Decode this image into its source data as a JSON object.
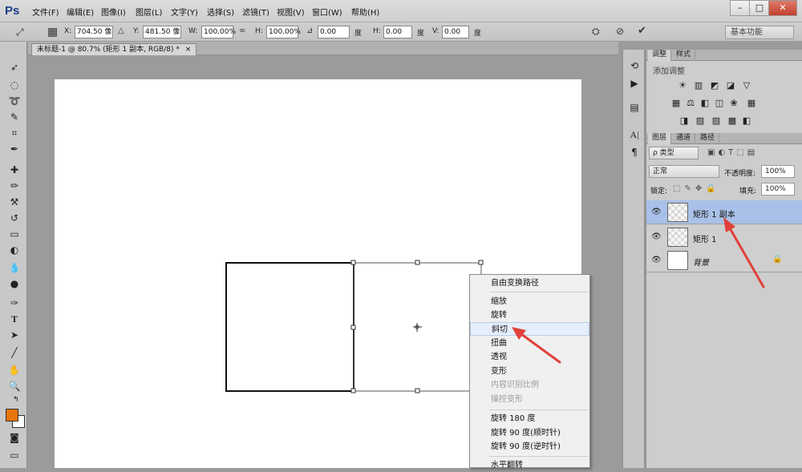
{
  "menubar": {
    "logo": "Ps",
    "items": [
      "文件(F)",
      "编辑(E)",
      "图像(I)",
      "图层(L)",
      "文字(Y)",
      "选择(S)",
      "滤镜(T)",
      "视图(V)",
      "窗口(W)",
      "帮助(H)"
    ],
    "window_buttons": {
      "minimize": "–",
      "restore": "□",
      "close": "✕"
    }
  },
  "options": {
    "x_label": "X:",
    "x_value": "704.50 像",
    "y_label": "Y:",
    "y_value": "481.50 像",
    "w_label": "W:",
    "w_value": "100.00%",
    "h_label": "H:",
    "h_value": "100.00%",
    "rot_value": "0.00",
    "rot_unit": "度",
    "hskew_label": "H:",
    "hskew_value": "0.00",
    "hskew_unit": "度",
    "vskew_label": "V:",
    "vskew_value": "0.00",
    "vskew_unit": "度",
    "workspace": "基本功能"
  },
  "document": {
    "tab_title": "未标题-1 @ 80.7% (矩形 1 副本, RGB/8) *"
  },
  "adjustments": {
    "tabs": [
      "调整",
      "样式"
    ],
    "header": "添加调整"
  },
  "layers": {
    "tabs": [
      "图层",
      "通道",
      "路径"
    ],
    "filter": "ρ 类型",
    "blend": "正常",
    "opacity_label": "不透明度:",
    "opacity": "100%",
    "lock_label": "锁定:",
    "fill_label": "填充:",
    "fill": "100%",
    "items": [
      {
        "name": "矩形 1 副本",
        "selected": true
      },
      {
        "name": "矩形 1",
        "selected": false
      },
      {
        "name": "背景",
        "selected": false
      }
    ]
  },
  "context_menu": {
    "items": [
      {
        "label": "自由变换路径",
        "disabled": false
      },
      {
        "label": "缩放",
        "disabled": false
      },
      {
        "label": "旋转",
        "disabled": false
      },
      {
        "label": "斜切",
        "disabled": false
      },
      {
        "label": "扭曲",
        "disabled": false
      },
      {
        "label": "透视",
        "disabled": false
      },
      {
        "label": "变形",
        "disabled": false
      },
      {
        "label": "内容识别比例",
        "disabled": true
      },
      {
        "label": "操控变形",
        "disabled": true
      },
      {
        "label": "旋转 180 度",
        "disabled": false
      },
      {
        "label": "旋转 90 度(顺时针)",
        "disabled": false
      },
      {
        "label": "旋转 90 度(逆时针)",
        "disabled": false
      },
      {
        "label": "水平翻转",
        "disabled": false
      }
    ],
    "highlighted": "斜切"
  },
  "colors": {
    "annotation_arrow": "#e0413a",
    "foreground": "#e8740c",
    "selection": "#a9c1e8"
  }
}
